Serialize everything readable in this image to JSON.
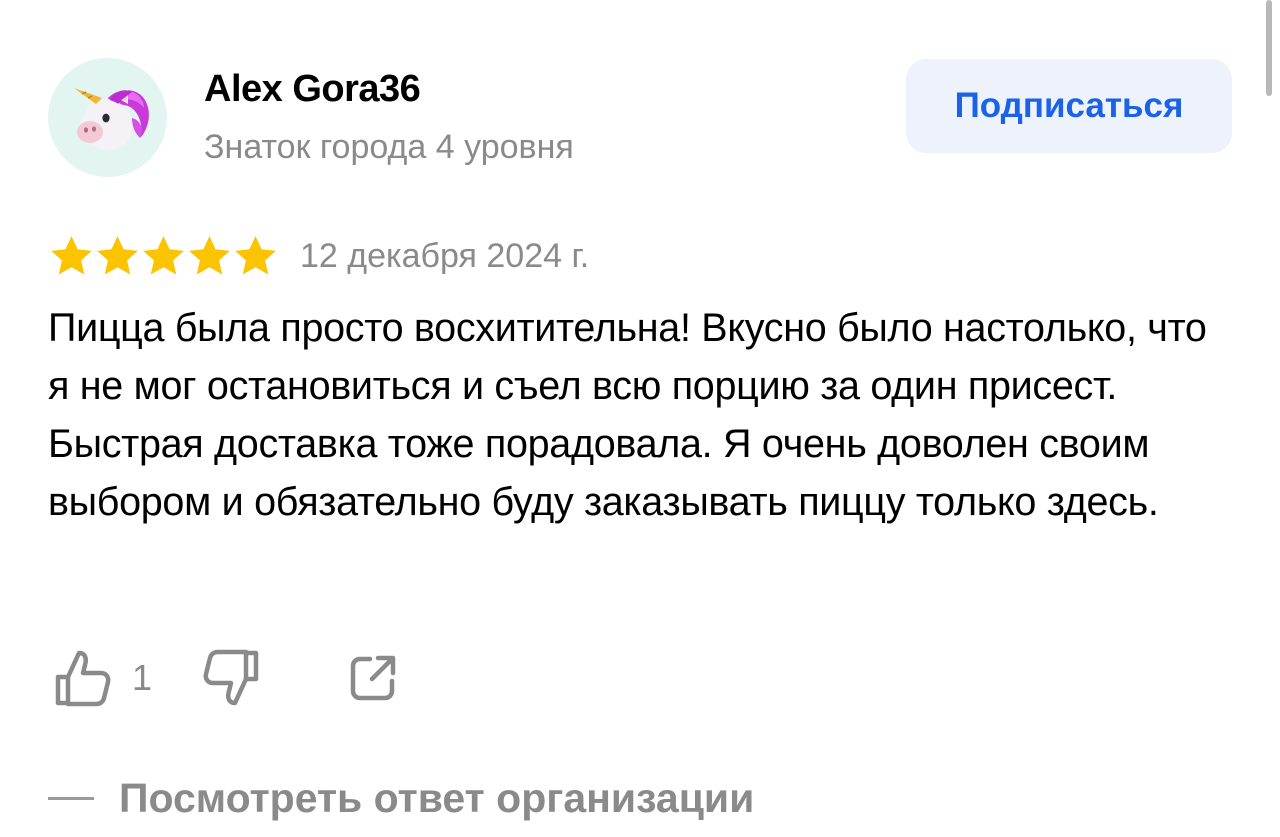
{
  "author": {
    "name": "Alex Gora36",
    "level": "Знаток города 4 уровня",
    "avatar_icon": "unicorn-icon"
  },
  "subscribe_button": {
    "label": "Подписаться",
    "color": "#1a63e8",
    "background": "#edf2fb"
  },
  "review": {
    "rating": 5,
    "rating_max": 5,
    "star_color": "#fcc400",
    "date": "12 декабря 2024 г.",
    "text": "Пицца была просто восхитительна! Вкусно было настолько, что я не мог остановиться и съел всю порцию за один присест. Быстрая доставка тоже порадовала. Я очень доволен своим выбором и обязательно буду заказывать пиццу только здесь."
  },
  "actions": {
    "like_icon": "thumbs-up-icon",
    "like_count": "1",
    "dislike_icon": "thumbs-down-icon",
    "share_icon": "share-icon"
  },
  "reply_link": {
    "label": "Посмотреть ответ организации"
  }
}
